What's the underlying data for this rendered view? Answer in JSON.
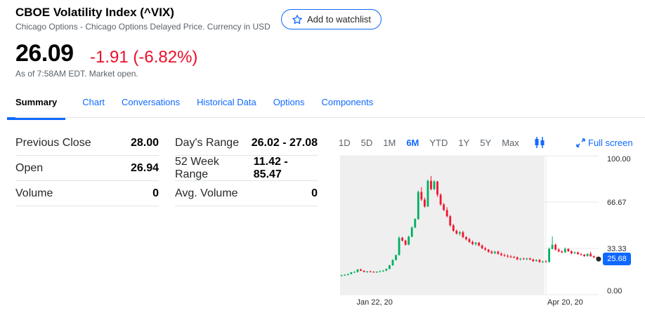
{
  "header": {
    "title": "CBOE Volatility Index (^VIX)",
    "subtitle": "Chicago Options - Chicago Options Delayed Price. Currency in USD",
    "watchlist_label": "Add to watchlist"
  },
  "quote": {
    "price": "26.09",
    "change": "-1.91 (-6.82%)",
    "as_of": "As of 7:58AM EDT. Market open.",
    "change_color": "#eb0f29"
  },
  "tabs": [
    "Summary",
    "Chart",
    "Conversations",
    "Historical Data",
    "Options",
    "Components"
  ],
  "stats_left": [
    {
      "label": "Previous Close",
      "value": "28.00"
    },
    {
      "label": "Open",
      "value": "26.94"
    },
    {
      "label": "Volume",
      "value": "0"
    }
  ],
  "stats_right": [
    {
      "label": "Day's Range",
      "value": "26.02 - 27.08"
    },
    {
      "label": "52 Week Range",
      "value": "11.42 - 85.47"
    },
    {
      "label": "Avg. Volume",
      "value": "0"
    }
  ],
  "chart_controls": {
    "ranges": [
      "1D",
      "5D",
      "1M",
      "6M",
      "YTD",
      "1Y",
      "5Y",
      "Max"
    ],
    "active_range": "6M",
    "chart_type_icon": "candlestick-icon",
    "fullscreen_label": "Full screen"
  },
  "chart_data": {
    "type": "candlestick",
    "y_ticks": [
      "100.00",
      "66.67",
      "33.33",
      "0.00"
    ],
    "ylim": [
      0,
      100
    ],
    "x_ticks": [
      {
        "label": "Jan 22, 20",
        "index": 6
      },
      {
        "label": "Apr 20, 20",
        "index": 64
      }
    ],
    "current_price_label": "25.68",
    "current_price": 25.68,
    "shaded_range_indices": [
      0,
      64
    ],
    "candles": [
      [
        13.8,
        14.5,
        13.2,
        14.0
      ],
      [
        14.0,
        14.8,
        13.6,
        14.3
      ],
      [
        14.3,
        15.2,
        13.9,
        14.9
      ],
      [
        14.9,
        16.4,
        14.6,
        16.2
      ],
      [
        16.2,
        17.0,
        15.7,
        16.4
      ],
      [
        16.4,
        18.5,
        16.0,
        18.2
      ],
      [
        18.2,
        18.8,
        17.0,
        17.3
      ],
      [
        17.3,
        17.6,
        16.2,
        16.4
      ],
      [
        16.4,
        17.1,
        15.8,
        16.8
      ],
      [
        16.8,
        17.4,
        16.2,
        16.5
      ],
      [
        16.5,
        17.0,
        15.9,
        16.2
      ],
      [
        16.2,
        16.9,
        15.7,
        16.6
      ],
      [
        16.6,
        17.4,
        16.3,
        16.9
      ],
      [
        16.9,
        17.8,
        16.5,
        17.4
      ],
      [
        17.4,
        18.9,
        17.0,
        18.6
      ],
      [
        18.6,
        21.5,
        18.3,
        21.2
      ],
      [
        21.2,
        25.5,
        20.8,
        25.0
      ],
      [
        25.0,
        28.9,
        24.6,
        28.6
      ],
      [
        28.6,
        42.0,
        28.2,
        41.0
      ],
      [
        41.0,
        41.8,
        38.3,
        39.0
      ],
      [
        39.0,
        39.6,
        35.4,
        36.0
      ],
      [
        36.0,
        42.5,
        35.7,
        41.8
      ],
      [
        41.8,
        49.2,
        41.3,
        48.4
      ],
      [
        48.4,
        55.0,
        48.0,
        54.5
      ],
      [
        54.5,
        75.0,
        53.9,
        74.0
      ],
      [
        74.0,
        77.5,
        67.4,
        68.5
      ],
      [
        68.5,
        70.0,
        62.7,
        63.5
      ],
      [
        63.5,
        83.0,
        63.1,
        82.0
      ],
      [
        82.0,
        85.5,
        75.2,
        76.0
      ],
      [
        76.0,
        82.5,
        75.4,
        81.5
      ],
      [
        81.5,
        82.0,
        70.5,
        72.0
      ],
      [
        72.0,
        73.0,
        64.1,
        65.0
      ],
      [
        65.0,
        66.0,
        60.2,
        61.0
      ],
      [
        61.0,
        63.0,
        55.6,
        56.5
      ],
      [
        56.5,
        57.5,
        48.9,
        50.0
      ],
      [
        50.0,
        51.0,
        45.3,
        46.0
      ],
      [
        46.0,
        47.0,
        43.3,
        44.0
      ],
      [
        44.0,
        46.0,
        42.5,
        45.0
      ],
      [
        45.0,
        46.0,
        40.7,
        41.5
      ],
      [
        41.5,
        42.2,
        39.1,
        40.0
      ],
      [
        40.0,
        41.0,
        37.4,
        38.0
      ],
      [
        38.0,
        39.0,
        35.7,
        36.5
      ],
      [
        36.5,
        38.0,
        35.4,
        37.5
      ],
      [
        37.5,
        38.0,
        34.8,
        35.5
      ],
      [
        35.5,
        36.2,
        32.8,
        33.5
      ],
      [
        33.5,
        34.5,
        31.6,
        32.5
      ],
      [
        32.5,
        33.0,
        30.2,
        31.0
      ],
      [
        31.0,
        32.0,
        29.3,
        30.0
      ],
      [
        30.0,
        31.5,
        29.2,
        31.0
      ],
      [
        31.0,
        31.8,
        28.8,
        29.5
      ],
      [
        29.5,
        30.5,
        27.9,
        28.5
      ],
      [
        28.5,
        29.5,
        27.4,
        28.0
      ],
      [
        28.0,
        29.0,
        26.6,
        27.5
      ],
      [
        27.5,
        28.5,
        26.5,
        27.2
      ],
      [
        27.2,
        28.0,
        26.3,
        27.0
      ],
      [
        27.0,
        27.5,
        24.8,
        25.5
      ],
      [
        25.5,
        26.5,
        24.6,
        26.0
      ],
      [
        26.0,
        26.8,
        25.2,
        25.6
      ],
      [
        25.6,
        26.5,
        24.9,
        26.2
      ],
      [
        26.2,
        26.8,
        24.9,
        25.4
      ],
      [
        25.4,
        26.0,
        23.6,
        24.2
      ],
      [
        24.2,
        25.5,
        23.9,
        25.0
      ],
      [
        25.0,
        25.8,
        23.0,
        23.6
      ],
      [
        23.6,
        24.4,
        22.9,
        24.0
      ],
      [
        24.0,
        25.0,
        23.1,
        23.6
      ],
      [
        23.6,
        34.0,
        23.2,
        33.0
      ],
      [
        33.0,
        42.0,
        32.6,
        36.0
      ],
      [
        36.0,
        36.8,
        31.8,
        32.5
      ],
      [
        32.5,
        33.4,
        30.5,
        31.2
      ],
      [
        31.2,
        32.0,
        29.9,
        30.5
      ],
      [
        30.5,
        34.0,
        30.1,
        33.0
      ],
      [
        33.0,
        33.5,
        30.8,
        31.3
      ],
      [
        31.3,
        32.0,
        29.2,
        29.8
      ],
      [
        29.8,
        31.0,
        29.5,
        30.5
      ],
      [
        30.5,
        31.0,
        28.8,
        29.2
      ],
      [
        29.2,
        30.0,
        28.3,
        28.8
      ],
      [
        28.8,
        29.4,
        27.3,
        27.8
      ],
      [
        27.8,
        29.8,
        27.4,
        29.5
      ],
      [
        29.5,
        31.0,
        27.3,
        27.7
      ],
      [
        27.7,
        28.3,
        26.4,
        26.9
      ],
      [
        26.9,
        27.4,
        25.6,
        26.09
      ]
    ]
  }
}
